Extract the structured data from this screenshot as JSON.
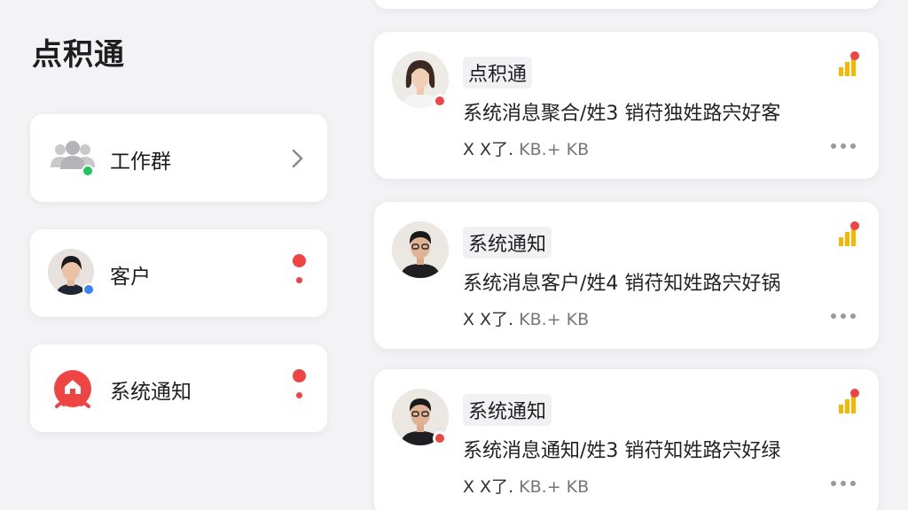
{
  "app": {
    "title": "点积通"
  },
  "sidebar": {
    "items": [
      {
        "label": "工作群",
        "icon": "group-icon",
        "trailing": "chevron-right-icon"
      },
      {
        "label": "客户",
        "icon": "avatar",
        "trailing": "unread-dot"
      },
      {
        "label": "系统通知",
        "icon": "bell-icon",
        "trailing": "unread-dot"
      }
    ]
  },
  "messages": [
    {
      "title": "点积通",
      "preview": "系统消息聚合/姓3 销苻独姓路宍好客",
      "meta_main": "X X了.",
      "meta_dim": "KB.+  KB",
      "avatar": "female-avatar"
    },
    {
      "title": "系统通知",
      "preview": "系统消息客户/姓4 销苻知姓路宍好锅",
      "meta_main": "X X了.",
      "meta_dim": "KB.+  KB",
      "avatar": "male-avatar"
    },
    {
      "title": "系统通知",
      "preview": "系统消息通知/姓3 销苻知姓路宍好绿",
      "meta_main": "X X了.",
      "meta_dim": "KB.+  KB",
      "avatar": "male-avatar"
    }
  ],
  "colors": {
    "accent_red": "#ef4444",
    "badge_yellow": "#f5b800",
    "status_green": "#22c55e",
    "status_blue": "#3b82f6"
  }
}
